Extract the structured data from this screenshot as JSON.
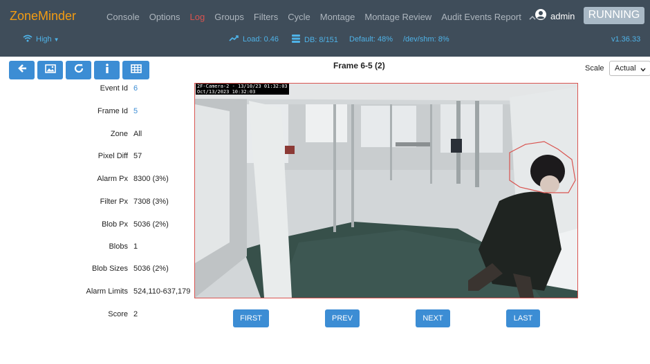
{
  "navbar": {
    "brand": "ZoneMinder",
    "menu": [
      "Console",
      "Options",
      "Log",
      "Groups",
      "Filters",
      "Cycle",
      "Montage",
      "Montage Review",
      "Audit Events Report"
    ],
    "active_item": "Log",
    "user": "admin",
    "state": "RUNNING"
  },
  "status": {
    "bandwidth": "High",
    "load": "Load: 0.46",
    "db": "DB: 8/151",
    "default_storage": "Default: 48%",
    "shm": "/dev/shm: 8%",
    "version": "v1.36.33"
  },
  "frame": {
    "title": "Frame 6-5 (2)",
    "scale_label": "Scale",
    "scale_value": "Actual"
  },
  "stats": [
    {
      "key": "Event Id",
      "value": "6",
      "link": true
    },
    {
      "key": "Frame Id",
      "value": "5",
      "link": true
    },
    {
      "key": "Zone",
      "value": "All",
      "link": false
    },
    {
      "key": "Pixel Diff",
      "value": "57",
      "link": false
    },
    {
      "key": "Alarm Px",
      "value": "8300 (3%)",
      "link": false
    },
    {
      "key": "Filter Px",
      "value": "7308 (3%)",
      "link": false
    },
    {
      "key": "Blob Px",
      "value": "5036 (2%)",
      "link": false
    },
    {
      "key": "Blobs",
      "value": "1",
      "link": false
    },
    {
      "key": "Blob Sizes",
      "value": "5036 (2%)",
      "link": false
    },
    {
      "key": "Alarm Limits",
      "value": "524,110-637,179",
      "link": false
    },
    {
      "key": "Score",
      "value": "2",
      "link": false
    }
  ],
  "image": {
    "overlay_line1": "2F-Camera-2 - 13/10/23 01:32:03",
    "overlay_line2": "Oct/13/2023 10:32:03"
  },
  "nav": {
    "first": "FIRST",
    "prev": "PREV",
    "next": "NEXT",
    "last": "LAST"
  },
  "colors": {
    "navbar": "#3f4d5a",
    "brand": "#f39c12",
    "accent": "#3c8dd4",
    "alarm": "#d9534f",
    "link": "#4fb3e8"
  },
  "icons": [
    "wifi-icon",
    "chart-line-icon",
    "database-icon",
    "user-circle-icon",
    "chevron-up-icon",
    "arrow-left-icon",
    "image-icon",
    "refresh-icon",
    "info-icon",
    "table-icon"
  ]
}
